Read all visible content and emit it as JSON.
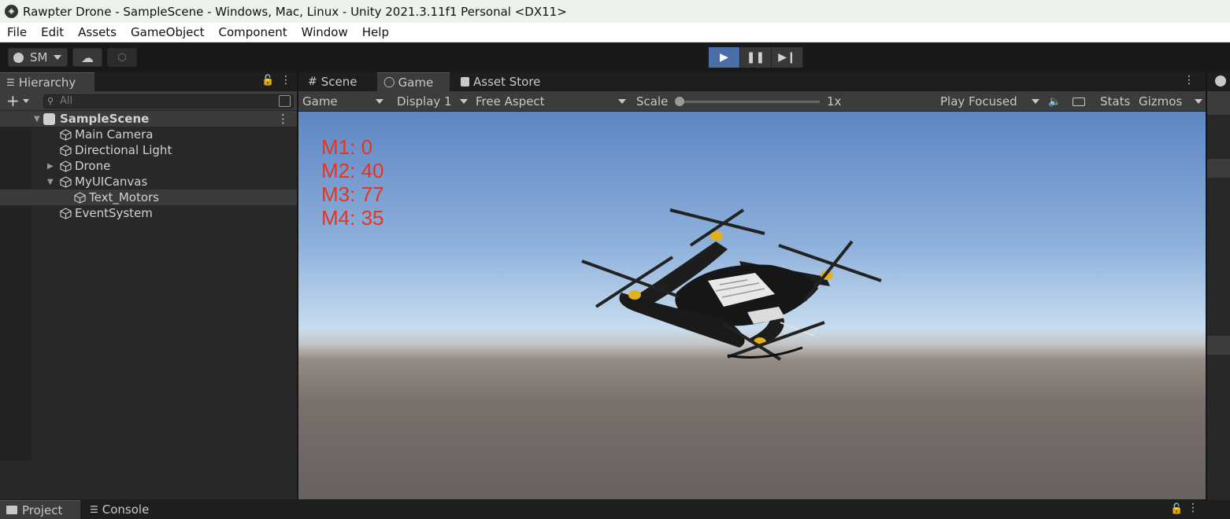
{
  "window": {
    "title": "Rawpter Drone - SampleScene - Windows, Mac, Linux - Unity 2021.3.11f1 Personal <DX11>"
  },
  "menu": [
    "File",
    "Edit",
    "Assets",
    "GameObject",
    "Component",
    "Window",
    "Help"
  ],
  "toolbar": {
    "account_label": "SM"
  },
  "hierarchy": {
    "tab_label": "Hierarchy",
    "search_placeholder": "All",
    "scene_name": "SampleScene",
    "items": [
      "Main Camera",
      "Directional Light",
      "Drone",
      "MyUICanvas",
      "Text_Motors",
      "EventSystem"
    ]
  },
  "view_tabs": [
    "Scene",
    "Game",
    "Asset Store"
  ],
  "game_controls": {
    "game_dropdown": "Game",
    "display_dropdown": "Display 1",
    "aspect_dropdown": "Free Aspect",
    "scale_label": "Scale",
    "scale_value": "1x",
    "play_mode": "Play Focused",
    "stats_label": "Stats",
    "gizmos_label": "Gizmos"
  },
  "motors": [
    "M1: 0",
    "M2: 40",
    "M3: 77",
    "M4: 35"
  ],
  "bottom_tabs": [
    "Project",
    "Console"
  ],
  "colors": {
    "motor_text": "#e8331e",
    "play_active": "#4a6fa5"
  }
}
